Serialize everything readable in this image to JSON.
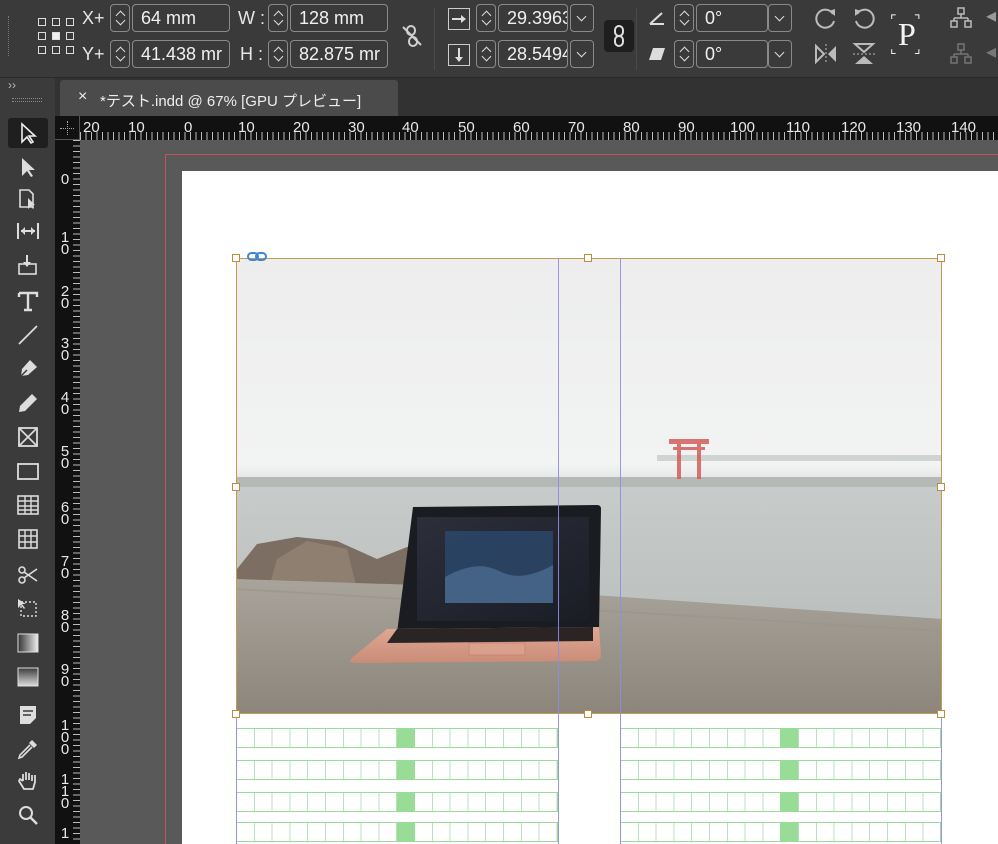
{
  "control_panel": {
    "x_label": "X+",
    "y_label": "Y+",
    "x_value": "64 mm",
    "y_value": "41.438 mr",
    "w_label": "W :",
    "h_label": "H :",
    "w_value": "128 mm",
    "h_value": "82.875 mr",
    "scale_x_value": "29.3963",
    "scale_y_value": "28.5494",
    "rotate_value": "0°",
    "shear_value": "0°",
    "p_glyph": "P"
  },
  "panel_toggle": "››",
  "tab": {
    "close": "×",
    "title": "*テスト.indd @ 67% [GPU プレビュー]"
  },
  "ruler": {
    "h_numbers": [
      "20",
      "10",
      "0",
      "10",
      "20",
      "30",
      "40",
      "50",
      "60",
      "70",
      "80",
      "90",
      "100",
      "110",
      "120",
      "130",
      "140"
    ],
    "v_numbers": [
      "0",
      "10",
      "20",
      "30",
      "40",
      "50",
      "60",
      "70",
      "80",
      "90",
      "100",
      "110",
      "1"
    ]
  },
  "colors": {
    "bleed": "#c0535e",
    "frame": "#c79a52",
    "guide": "#8f8ce6",
    "grid": "#98dc98",
    "link": "#3a88d8"
  },
  "tools": [
    "selection-tool",
    "direct-selection-tool",
    "page-tool",
    "gap-tool",
    "content-collector-tool",
    "type-tool",
    "line-tool",
    "pen-tool",
    "pencil-tool",
    "rectangle-frame-tool",
    "rectangle-tool",
    "table-tool",
    "table-tool-2",
    "scissors-tool",
    "free-transform-tool",
    "gradient-swatch-tool",
    "gradient-feather-tool",
    "note-tool",
    "eyedropper-tool",
    "hand-tool",
    "zoom-tool"
  ]
}
